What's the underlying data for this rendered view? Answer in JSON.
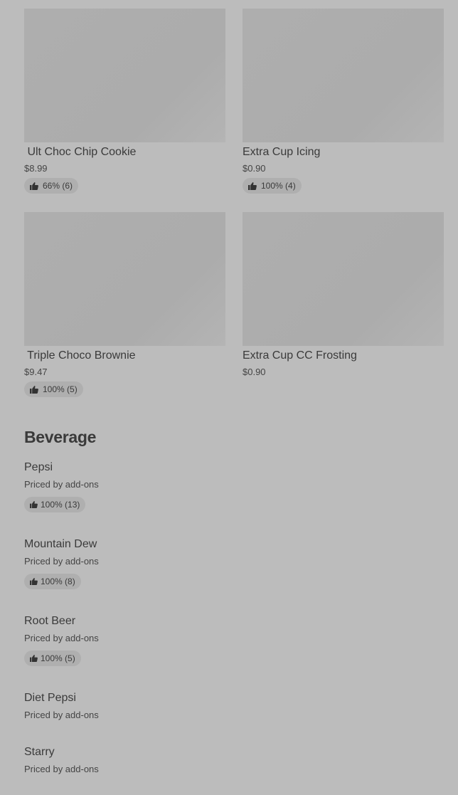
{
  "products": [
    {
      "name": " Ult Choc Chip Cookie",
      "price": "$8.99",
      "rating": "66% (6)"
    },
    {
      "name": "Extra Cup Icing",
      "price": "$0.90",
      "rating": "100% (4)"
    },
    {
      "name": " Triple Choco Brownie",
      "price": "$9.47",
      "rating": "100% (5)"
    },
    {
      "name": "Extra Cup CC Frosting",
      "price": "$0.90",
      "rating": ""
    }
  ],
  "beverage": {
    "title": "Beverage",
    "items": [
      {
        "name": "Pepsi",
        "subtitle": "Priced by add-ons",
        "rating": "100% (13)"
      },
      {
        "name": "Mountain Dew",
        "subtitle": "Priced by add-ons",
        "rating": "100% (8)"
      },
      {
        "name": "Root Beer",
        "subtitle": "Priced by add-ons",
        "rating": "100% (5)"
      },
      {
        "name": "Diet Pepsi",
        "subtitle": "Priced by add-ons",
        "rating": ""
      },
      {
        "name": "Starry",
        "subtitle": "Priced by add-ons",
        "rating": ""
      }
    ]
  },
  "icons": {
    "rating": "thumbs-up-icon"
  },
  "colors": {
    "background": "#bcbcbc",
    "thumbnail": "#adadad",
    "badge": "#afafaf",
    "text": "#3a3a3a"
  }
}
